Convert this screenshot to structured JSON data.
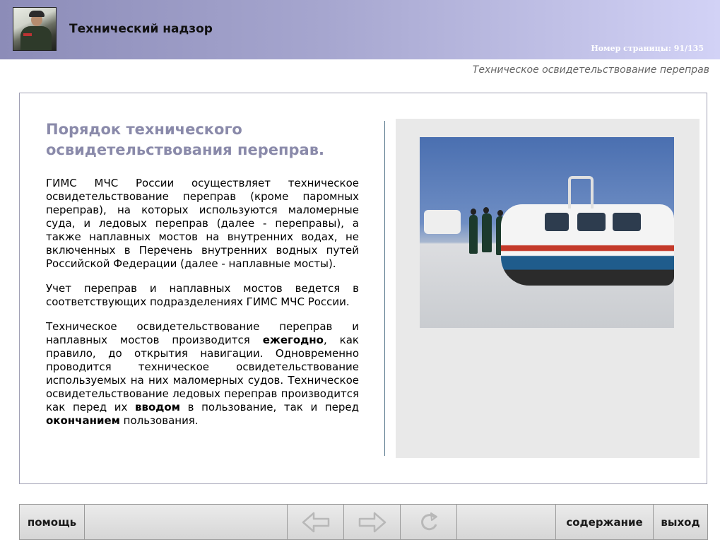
{
  "header": {
    "title": "Технический надзор",
    "page_number": "Номер страницы: 91/135"
  },
  "section_title": "Техническое освидетельствование переправ",
  "main": {
    "heading": "Порядок технического освидетельствования переправ.",
    "p1": "ГИМС МЧС России осуществляет техническое освидетельствование переправ (кроме паромных переправ), на которых используются маломерные суда, и ледовых переправ (далее - переправы), а также наплавных мостов на внутренних водах, не включенных в Перечень внутренних водных путей Российской Федерации (далее - наплавные мосты).",
    "p2": "Учет переправ и наплавных мостов ведется в соответствующих подразделениях ГИМС МЧС России.",
    "p3_a": "Техническое освидетельствование переправ и наплавных мостов производится ",
    "p3_b": "ежегодно",
    "p3_c": ", как правило, до открытия навигации. Одновременно проводится техническое освидетельствование используемых на них маломерных судов. Техническое освидетельствование ледовых переправ производится как перед их ",
    "p3_d": "вводом",
    "p3_e": " в пользование, так и перед ",
    "p3_f": "окончанием",
    "p3_g": " пользования."
  },
  "footer": {
    "help": "помощь",
    "back_icon": "arrow-left-icon",
    "forward_icon": "arrow-right-icon",
    "refresh_icon": "refresh-icon",
    "contents": "содержание",
    "exit": "выход"
  }
}
